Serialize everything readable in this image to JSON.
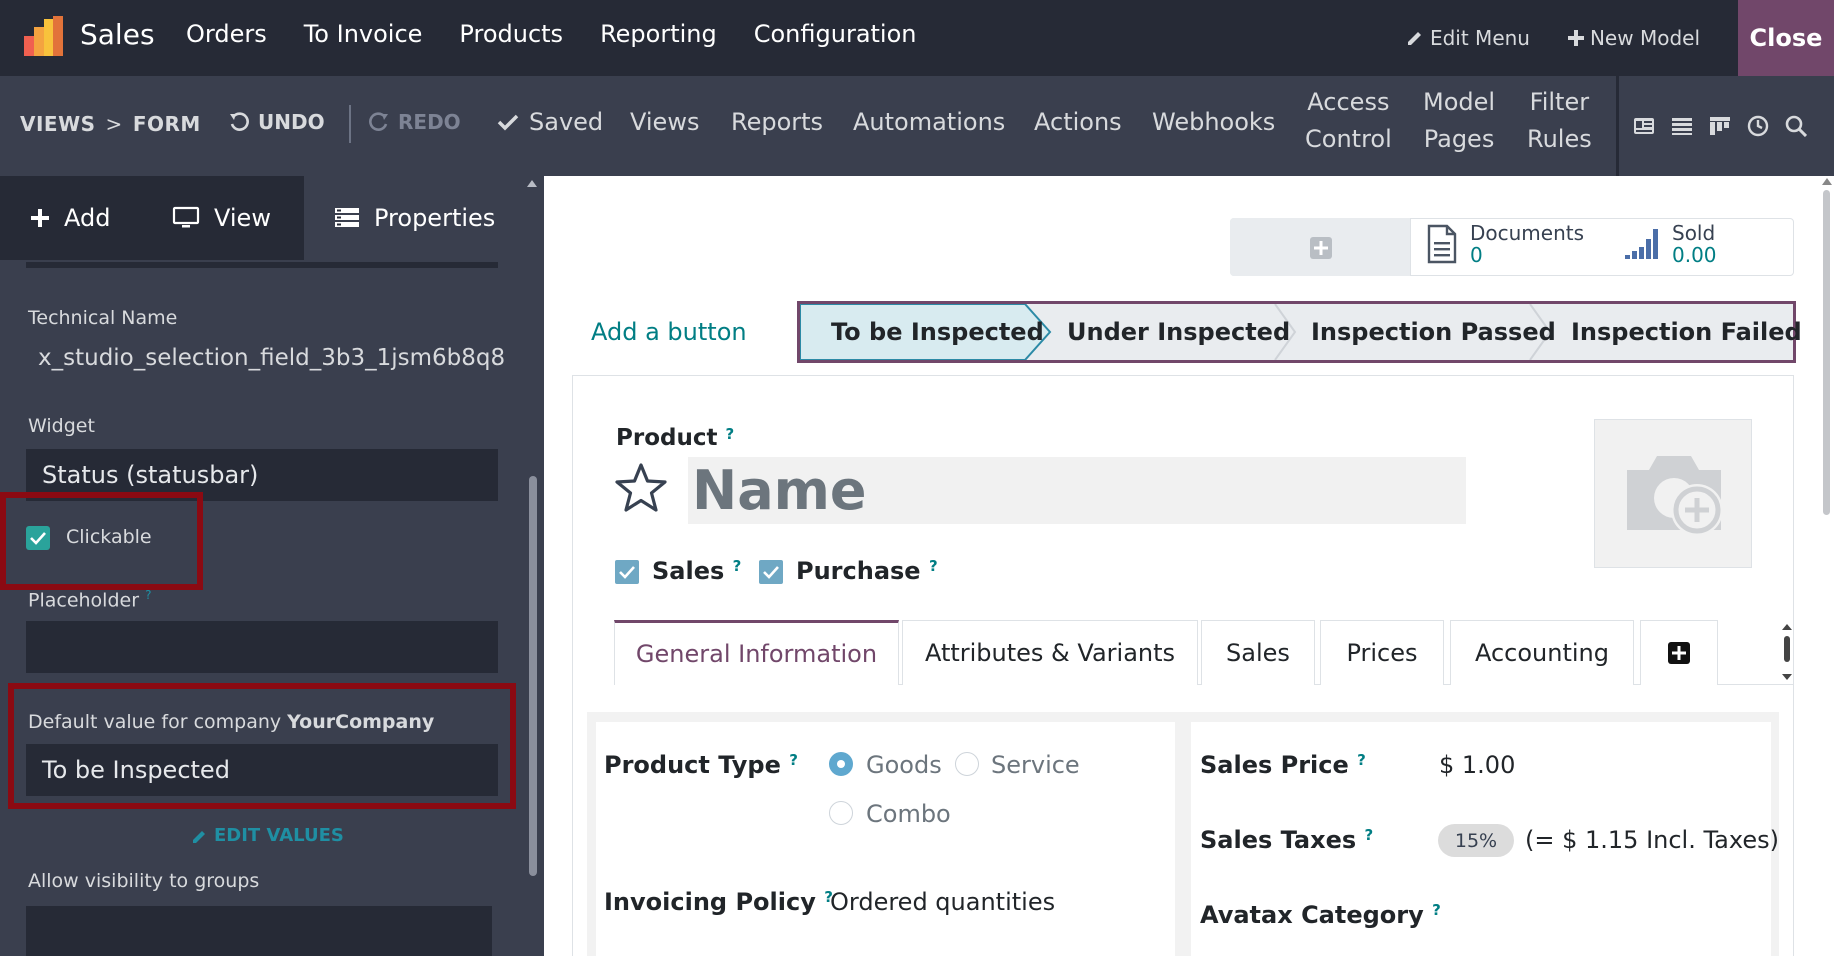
{
  "navbar": {
    "app_name": "Sales",
    "menu": [
      "Orders",
      "To Invoice",
      "Products",
      "Reporting",
      "Configuration"
    ],
    "edit_menu": "Edit Menu",
    "new_model": "New Model",
    "close": "Close"
  },
  "toolbar": {
    "breadcrumb_views": "VIEWS",
    "breadcrumb_sep": ">",
    "breadcrumb_form": "FORM",
    "undo": "UNDO",
    "redo": "REDO",
    "saved": "Saved",
    "views": "Views",
    "reports": "Reports",
    "automations": "Automations",
    "actions": "Actions",
    "webhooks": "Webhooks",
    "access_control_1": "Access",
    "access_control_2": "Control",
    "model_pages_1": "Model",
    "model_pages_2": "Pages",
    "filter_rules_1": "Filter",
    "filter_rules_2": "Rules"
  },
  "sidebar": {
    "tab_add": "Add",
    "tab_view": "View",
    "tab_properties": "Properties",
    "technical_name_label": "Technical Name",
    "technical_name_value": "x_studio_selection_field_3b3_1jsm6b8q8",
    "widget_label": "Widget",
    "widget_value": "Status (statusbar)",
    "clickable_label": "Clickable",
    "placeholder_label": "Placeholder",
    "placeholder_q": "?",
    "default_label_prefix": "Default value for company ",
    "default_label_company": "YourCompany",
    "default_value": "To be Inspected",
    "edit_values": "EDIT VALUES",
    "visibility_label": "Allow visibility to groups"
  },
  "form": {
    "smart_documents_label": "Documents",
    "smart_documents_value": "0",
    "smart_sold_label": "Sold",
    "smart_sold_value": "0.00",
    "add_button": "Add a button",
    "stages": [
      "To be Inspected",
      "Under Inspected",
      "Inspection Passed",
      "Inspection Failed"
    ],
    "product_label": "Product",
    "q": "?",
    "name_placeholder": "Name",
    "sales_check": "Sales",
    "purchase_check": "Purchase",
    "tabs": [
      "General Information",
      "Attributes & Variants",
      "Sales",
      "Prices",
      "Accounting"
    ],
    "product_type_label": "Product Type",
    "type_goods": "Goods",
    "type_service": "Service",
    "type_combo": "Combo",
    "invoicing_policy_label": "Invoicing Policy",
    "invoicing_policy_value": "Ordered quantities",
    "sales_price_label": "Sales Price",
    "sales_price_value": "$ 1.00",
    "sales_taxes_label": "Sales Taxes",
    "sales_taxes_badge": "15%",
    "sales_taxes_incl": "(= $ 1.15 Incl. Taxes)",
    "avatax_label": "Avatax Category"
  },
  "colors": {
    "navbar": "#262a36",
    "toolbar": "#3a3f4e",
    "close_bg": "#71476a",
    "highlight_red": "#8b0a12",
    "teal": "#017e84"
  }
}
